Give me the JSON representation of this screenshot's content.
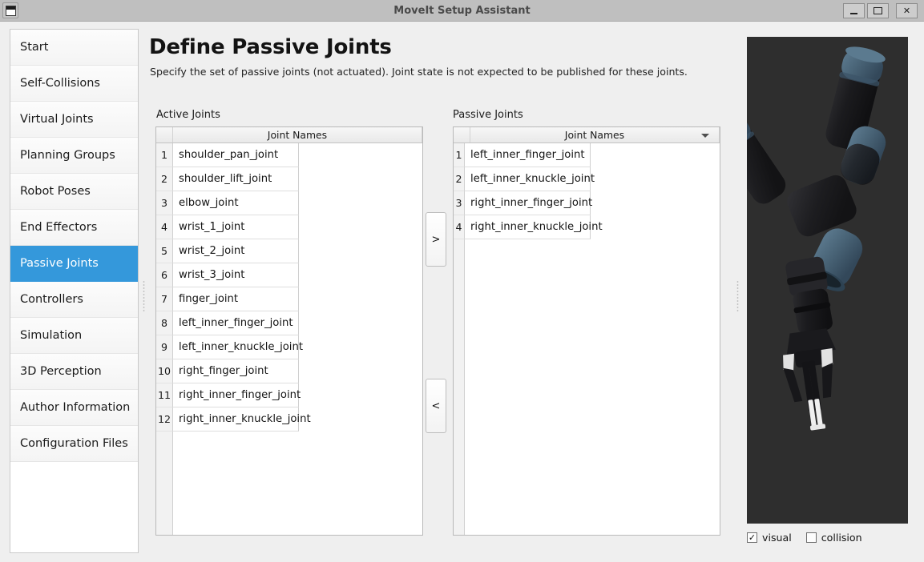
{
  "window": {
    "title": "MoveIt Setup Assistant",
    "app_icon": "window-icon",
    "minimize_label": "",
    "maximize_label": "",
    "close_label": "✕"
  },
  "sidebar": {
    "items": [
      {
        "label": "Start",
        "selected": false
      },
      {
        "label": "Self-Collisions",
        "selected": false
      },
      {
        "label": "Virtual Joints",
        "selected": false
      },
      {
        "label": "Planning Groups",
        "selected": false
      },
      {
        "label": "Robot Poses",
        "selected": false
      },
      {
        "label": "End Effectors",
        "selected": false
      },
      {
        "label": "Passive Joints",
        "selected": true
      },
      {
        "label": "Controllers",
        "selected": false
      },
      {
        "label": "Simulation",
        "selected": false
      },
      {
        "label": "3D Perception",
        "selected": false
      },
      {
        "label": "Author Information",
        "selected": false
      },
      {
        "label": "Configuration Files",
        "selected": false
      }
    ]
  },
  "main": {
    "title": "Define Passive Joints",
    "description": "Specify the set of passive joints (not actuated). Joint state is not expected to be published for these joints.",
    "active": {
      "label": "Active Joints",
      "column_header": "Joint Names",
      "sorted": false,
      "rows": [
        {
          "n": "1",
          "name": "shoulder_pan_joint"
        },
        {
          "n": "2",
          "name": "shoulder_lift_joint"
        },
        {
          "n": "3",
          "name": "elbow_joint"
        },
        {
          "n": "4",
          "name": "wrist_1_joint"
        },
        {
          "n": "5",
          "name": "wrist_2_joint"
        },
        {
          "n": "6",
          "name": "wrist_3_joint"
        },
        {
          "n": "7",
          "name": "finger_joint"
        },
        {
          "n": "8",
          "name": "left_inner_finger_joint"
        },
        {
          "n": "9",
          "name": "left_inner_knuckle_joint"
        },
        {
          "n": "10",
          "name": "right_finger_joint"
        },
        {
          "n": "11",
          "name": "right_inner_finger_joint"
        },
        {
          "n": "12",
          "name": "right_inner_knuckle_joint"
        }
      ]
    },
    "passive": {
      "label": "Passive Joints",
      "column_header": "Joint Names",
      "sorted": true,
      "sort_indicator": "sort-descending-arrow",
      "rows": [
        {
          "n": "1",
          "name": "left_inner_finger_joint"
        },
        {
          "n": "2",
          "name": "left_inner_knuckle_joint"
        },
        {
          "n": "3",
          "name": "right_inner_finger_joint"
        },
        {
          "n": "4",
          "name": "right_inner_knuckle_joint"
        }
      ]
    },
    "transfer": {
      "to_passive_label": ">",
      "to_active_label": "<"
    }
  },
  "viewport": {
    "background_color": "#2e2e2e",
    "robot_body_color": "#1d1d1f",
    "robot_accent_color": "#49657a",
    "options": [
      {
        "label": "visual",
        "checked": true,
        "mark": "✓"
      },
      {
        "label": "collision",
        "checked": false,
        "mark": ""
      }
    ]
  },
  "colors": {
    "selection_blue": "#3498db",
    "window_chrome": "#bfbfbf",
    "page_background": "#efefef"
  }
}
